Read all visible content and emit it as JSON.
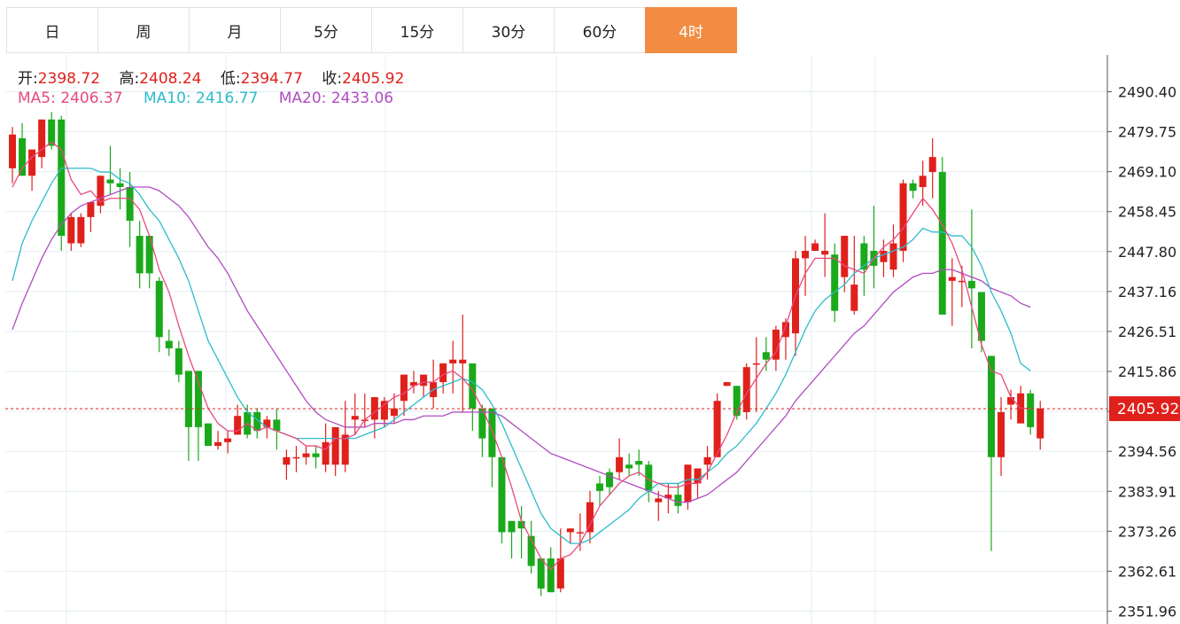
{
  "tabs": [
    {
      "label": "日",
      "active": false
    },
    {
      "label": "周",
      "active": false
    },
    {
      "label": "月",
      "active": false
    },
    {
      "label": "5分",
      "active": false
    },
    {
      "label": "15分",
      "active": false
    },
    {
      "label": "30分",
      "active": false
    },
    {
      "label": "60分",
      "active": false
    },
    {
      "label": "4时",
      "active": true
    }
  ],
  "ohlc": {
    "open_label": "开:",
    "open": "2398.72",
    "high_label": "高:",
    "high": "2408.24",
    "low_label": "低:",
    "low": "2394.77",
    "close_label": "收:",
    "close": "2405.92"
  },
  "ma": {
    "ma5_label": "MA5:",
    "ma5": "2406.37",
    "ma10_label": "MA10:",
    "ma10": "2416.77",
    "ma20_label": "MA20:",
    "ma20": "2433.06"
  },
  "colors": {
    "up": "#e0201b",
    "down": "#1aa91a",
    "ma5": "#e84a7e",
    "ma10": "#2cbccb",
    "ma20": "#b04dc0",
    "active_tab": "#f28c43",
    "last_price_badge": "#e0201b"
  },
  "chart_data": {
    "type": "candlestick",
    "y_ticks": [
      "2490.40",
      "2479.75",
      "2469.10",
      "2458.45",
      "2447.80",
      "2437.16",
      "2426.51",
      "2415.86",
      "2405.21",
      "2394.56",
      "2383.91",
      "2373.26",
      "2362.61",
      "2351.96"
    ],
    "ylim": [
      2351.96,
      2490.4
    ],
    "last_price": "2405.92",
    "grid": true,
    "candles": [
      [
        2470,
        2481,
        2466,
        2479
      ],
      [
        2478,
        2482,
        2468,
        2468
      ],
      [
        2468,
        2475,
        2464,
        2475
      ],
      [
        2473,
        2483,
        2470,
        2483
      ],
      [
        2483,
        2485,
        2475,
        2476
      ],
      [
        2483,
        2484,
        2448,
        2452
      ],
      [
        2450,
        2458,
        2448,
        2457
      ],
      [
        2450,
        2458,
        2449,
        2457
      ],
      [
        2457,
        2461,
        2453,
        2461
      ],
      [
        2460,
        2468,
        2458,
        2468
      ],
      [
        2467,
        2476,
        2463,
        2466
      ],
      [
        2466,
        2470,
        2459,
        2465
      ],
      [
        2465,
        2469,
        2449,
        2456
      ],
      [
        2452,
        2456,
        2438,
        2442
      ],
      [
        2452,
        2452,
        2438,
        2442
      ],
      [
        2440,
        2441,
        2421,
        2425
      ],
      [
        2424,
        2427,
        2420,
        2422
      ],
      [
        2422,
        2424,
        2413,
        2415
      ],
      [
        2416,
        2416,
        2392,
        2401
      ],
      [
        2416,
        2416,
        2392,
        2401
      ],
      [
        2402,
        2402,
        2398,
        2396
      ],
      [
        2396,
        2400,
        2395,
        2397
      ],
      [
        2397,
        2400,
        2394,
        2398
      ],
      [
        2399,
        2407,
        2399,
        2404
      ],
      [
        2405,
        2407,
        2398,
        2399
      ],
      [
        2405,
        2406,
        2398,
        2400
      ],
      [
        2401,
        2404,
        2398,
        2403
      ],
      [
        2403,
        2406,
        2395,
        2400
      ],
      [
        2391,
        2395,
        2387,
        2393
      ],
      [
        2393,
        2396,
        2389,
        2393
      ],
      [
        2393,
        2396,
        2391,
        2394
      ],
      [
        2394,
        2396,
        2390,
        2393
      ],
      [
        2391,
        2402,
        2389,
        2397
      ],
      [
        2391,
        2401,
        2388,
        2401
      ],
      [
        2391,
        2408,
        2389,
        2399
      ],
      [
        2403,
        2410,
        2399,
        2404
      ],
      [
        2403,
        2410,
        2401,
        2403
      ],
      [
        2403,
        2409,
        2398,
        2409
      ],
      [
        2403,
        2409,
        2401,
        2408
      ],
      [
        2404,
        2410,
        2402,
        2406
      ],
      [
        2408,
        2415,
        2404,
        2415
      ],
      [
        2412,
        2416,
        2410,
        2413
      ],
      [
        2412,
        2415,
        2409,
        2415
      ],
      [
        2409,
        2419,
        2406,
        2413
      ],
      [
        2413,
        2418,
        2410,
        2418
      ],
      [
        2418,
        2424,
        2410,
        2419
      ],
      [
        2418,
        2431,
        2405,
        2419
      ],
      [
        2418,
        2418,
        2400,
        2406
      ],
      [
        2406,
        2407,
        2393,
        2398
      ],
      [
        2406,
        2406,
        2385,
        2393
      ],
      [
        2393,
        2393,
        2370,
        2373
      ],
      [
        2376,
        2376,
        2366,
        2373
      ],
      [
        2376,
        2380,
        2366,
        2374
      ],
      [
        2372,
        2376,
        2362,
        2364
      ],
      [
        2366,
        2366,
        2356,
        2358
      ],
      [
        2366,
        2369,
        2357,
        2357
      ],
      [
        2358,
        2374,
        2357,
        2366
      ],
      [
        2373,
        2374,
        2370,
        2374
      ],
      [
        2373,
        2378,
        2368,
        2373
      ],
      [
        2373,
        2384,
        2370,
        2381
      ],
      [
        2386,
        2388,
        2380,
        2384
      ],
      [
        2389,
        2390,
        2383,
        2385
      ],
      [
        2389,
        2398,
        2387,
        2393
      ],
      [
        2391,
        2394,
        2388,
        2390
      ],
      [
        2392,
        2395,
        2388,
        2391
      ],
      [
        2391,
        2392,
        2381,
        2384
      ],
      [
        2381,
        2384,
        2376,
        2382
      ],
      [
        2382,
        2386,
        2378,
        2383
      ],
      [
        2383,
        2386,
        2378,
        2380
      ],
      [
        2381,
        2391,
        2379,
        2391
      ],
      [
        2386,
        2389,
        2382,
        2390
      ],
      [
        2391,
        2396,
        2387,
        2393
      ],
      [
        2393,
        2410,
        2393,
        2408
      ],
      [
        2412,
        2413,
        2412,
        2413
      ],
      [
        2412,
        2412,
        2403,
        2404
      ],
      [
        2405,
        2418,
        2403,
        2417
      ],
      [
        2418,
        2425,
        2405,
        2418
      ],
      [
        2421,
        2425,
        2416,
        2419
      ],
      [
        2419,
        2428,
        2416,
        2427
      ],
      [
        2425,
        2430,
        2419,
        2429
      ],
      [
        2426,
        2448,
        2420,
        2446
      ],
      [
        2446,
        2452,
        2436,
        2448
      ],
      [
        2448,
        2451,
        2448,
        2450
      ],
      [
        2447,
        2458,
        2441,
        2448
      ],
      [
        2447,
        2450,
        2429,
        2432
      ],
      [
        2441,
        2450,
        2437,
        2452
      ],
      [
        2432,
        2452,
        2431,
        2439
      ],
      [
        2450,
        2452,
        2436,
        2443
      ],
      [
        2448,
        2460,
        2438,
        2444
      ],
      [
        2445,
        2451,
        2441,
        2448
      ],
      [
        2443,
        2455,
        2441,
        2450
      ],
      [
        2448,
        2467,
        2445,
        2466
      ],
      [
        2466,
        2467,
        2462,
        2464
      ],
      [
        2465,
        2472,
        2460,
        2468
      ],
      [
        2469,
        2478,
        2462,
        2473
      ],
      [
        2469,
        2473,
        2431,
        2431
      ],
      [
        2440,
        2446,
        2428,
        2441
      ],
      [
        2440,
        2444,
        2433,
        2440
      ],
      [
        2440,
        2459,
        2422,
        2438
      ],
      [
        2437,
        2437,
        2421,
        2424
      ],
      [
        2420,
        2420,
        2368,
        2393
      ],
      [
        2393,
        2409,
        2388,
        2405
      ],
      [
        2407,
        2411,
        2403,
        2409
      ],
      [
        2402,
        2412,
        2403,
        2410
      ],
      [
        2410,
        2411,
        2399,
        2401
      ],
      [
        2398,
        2408,
        2395,
        2406
      ]
    ],
    "ma5": [
      2465,
      2470,
      2473,
      2475,
      2477,
      2475,
      2467,
      2463,
      2464,
      2461,
      2462,
      2462,
      2462,
      2459,
      2452,
      2443,
      2437,
      2428,
      2420,
      2413,
      2406,
      2402,
      2400,
      2400,
      2402,
      2400,
      2401,
      2400,
      2399,
      2398,
      2396,
      2396,
      2395,
      2398,
      2398,
      2399,
      2403,
      2405,
      2407,
      2409,
      2410,
      2412,
      2413,
      2413,
      2415,
      2416,
      2414,
      2411,
      2406,
      2400,
      2393,
      2385,
      2376,
      2371,
      2366,
      2363,
      2366,
      2367,
      2370,
      2375,
      2380,
      2383,
      2386,
      2388,
      2389,
      2387,
      2386,
      2385,
      2385,
      2386,
      2386,
      2389,
      2394,
      2399,
      2405,
      2410,
      2414,
      2418,
      2421,
      2428,
      2436,
      2442,
      2446,
      2446,
      2446,
      2444,
      2443,
      2442,
      2446,
      2449,
      2451,
      2454,
      2458,
      2462,
      2459,
      2455,
      2450,
      2443,
      2433,
      2423,
      2416,
      2415,
      2409,
      2406,
      2406
    ],
    "ma10": [
      2440,
      2450,
      2456,
      2461,
      2466,
      2470,
      2470,
      2470,
      2470,
      2469,
      2469,
      2467,
      2466,
      2463,
      2459,
      2456,
      2451,
      2446,
      2440,
      2432,
      2424,
      2419,
      2414,
      2409,
      2405,
      2403,
      2401,
      2400,
      2399,
      2398,
      2398,
      2398,
      2398,
      2398,
      2398,
      2398,
      2399,
      2400,
      2401,
      2403,
      2405,
      2407,
      2409,
      2411,
      2412,
      2413,
      2414,
      2413,
      2411,
      2407,
      2402,
      2396,
      2390,
      2384,
      2378,
      2374,
      2372,
      2370,
      2370,
      2371,
      2373,
      2375,
      2377,
      2379,
      2382,
      2384,
      2386,
      2386,
      2386,
      2387,
      2387,
      2389,
      2391,
      2394,
      2396,
      2399,
      2402,
      2406,
      2410,
      2415,
      2421,
      2427,
      2432,
      2435,
      2437,
      2439,
      2442,
      2444,
      2446,
      2447,
      2448,
      2449,
      2451,
      2454,
      2453,
      2453,
      2452,
      2452,
      2449,
      2444,
      2437,
      2432,
      2426,
      2418,
      2416
    ],
    "ma20": [
      2427,
      2434,
      2440,
      2446,
      2451,
      2455,
      2458,
      2460,
      2461,
      2462,
      2463,
      2464,
      2465,
      2465,
      2465,
      2464,
      2462,
      2460,
      2457,
      2453,
      2449,
      2446,
      2442,
      2437,
      2432,
      2428,
      2424,
      2420,
      2416,
      2412,
      2408,
      2405,
      2403,
      2402,
      2401,
      2401,
      2401,
      2402,
      2402,
      2402,
      2403,
      2403,
      2404,
      2404,
      2404,
      2405,
      2405,
      2405,
      2405,
      2405,
      2404,
      2402,
      2400,
      2398,
      2396,
      2394,
      2393,
      2392,
      2391,
      2390,
      2389,
      2388,
      2387,
      2386,
      2385,
      2384,
      2383,
      2382,
      2381,
      2381,
      2382,
      2383,
      2385,
      2387,
      2389,
      2392,
      2395,
      2398,
      2401,
      2404,
      2408,
      2411,
      2414,
      2417,
      2420,
      2423,
      2426,
      2428,
      2431,
      2434,
      2437,
      2439,
      2441,
      2442,
      2442,
      2443,
      2443,
      2442,
      2441,
      2440,
      2438,
      2437,
      2436,
      2434,
      2433
    ]
  }
}
